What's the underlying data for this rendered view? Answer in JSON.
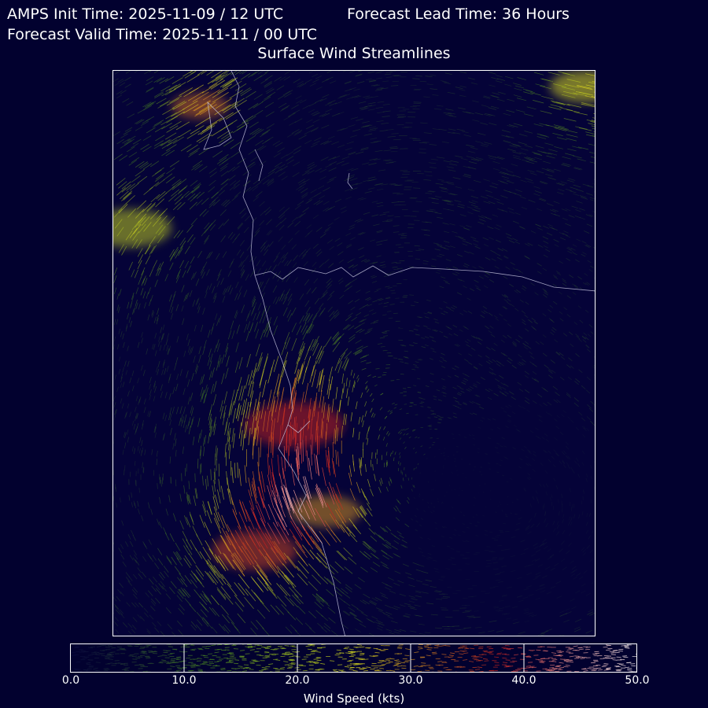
{
  "header": {
    "init_time": "AMPS Init Time: 2025-11-09 / 12 UTC",
    "lead_time": "Forecast Lead Time: 36 Hours",
    "valid_time": "Forecast Valid Time: 2025-11-11 / 00 UTC",
    "title": "Surface Wind Streamlines"
  },
  "colorbar": {
    "label": "Wind Speed (kts)",
    "ticks": [
      "0.0",
      "10.0",
      "20.0",
      "30.0",
      "40.0",
      "50.0"
    ],
    "range": [
      0,
      50
    ],
    "colors": [
      "#0a0a40",
      "#4a8a20",
      "#d8d820",
      "#c02020",
      "#ffffff"
    ]
  },
  "colors": {
    "background": "#02012f",
    "coastline": "#c8c8e0"
  }
}
